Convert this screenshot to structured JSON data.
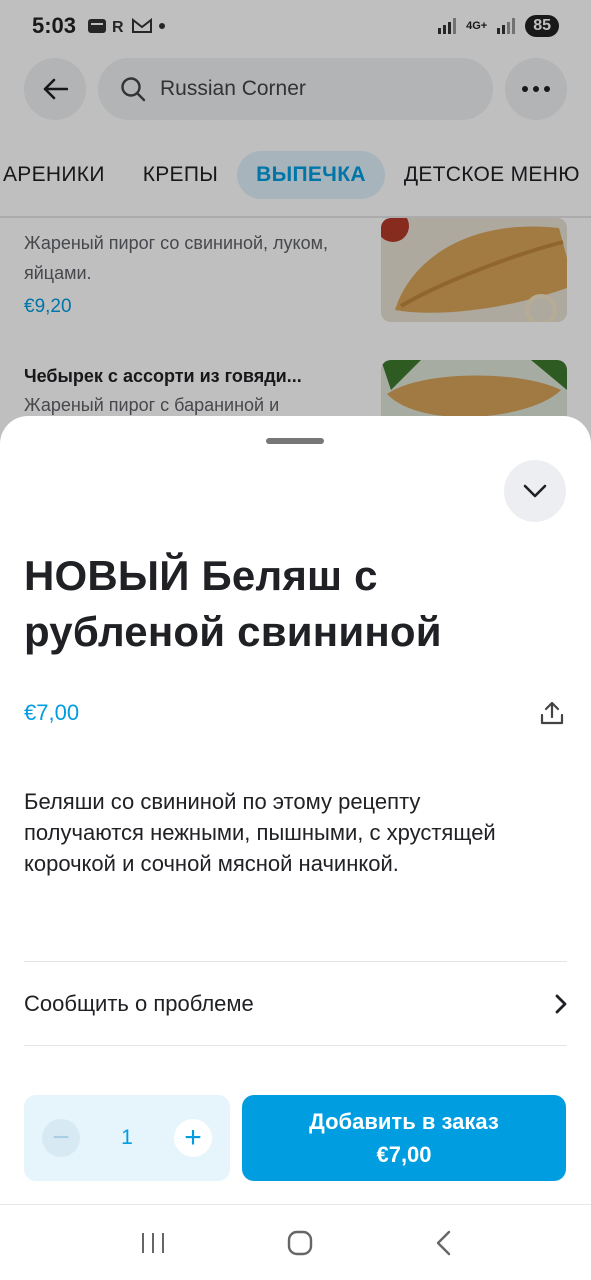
{
  "status_bar": {
    "time": "5:03",
    "left_icons": [
      "message-icon",
      "r-icon",
      "mail-icon",
      "dot-icon"
    ],
    "network_label": "4G+",
    "battery": "85"
  },
  "search": {
    "query": "Russian Corner"
  },
  "category_tabs": [
    {
      "label": "АРЕНИКИ",
      "active": false
    },
    {
      "label": "КРЕПЫ",
      "active": false
    },
    {
      "label": "ВЫПЕЧКА",
      "active": true
    },
    {
      "label": "ДЕТСКОЕ МЕНЮ",
      "active": false
    }
  ],
  "background_items": [
    {
      "title": "",
      "description": "Жареный пирог со свининой, луком, яйцами.",
      "price": "€9,20"
    },
    {
      "title": "Чебырек с ассорти из говяди...",
      "description": "Жареный пирог с бараниной и",
      "price": ""
    }
  ],
  "product": {
    "title": "НОВЫЙ Беляш с рубленой свининой",
    "price": "€7,00",
    "description": "Беляши со свининой по этому рецепту получаются нежными, пышными, с хрустящей корочкой и сочной мясной начинкой.",
    "report_label": "Сообщить о проблеме"
  },
  "order": {
    "quantity": "1",
    "minus_symbol": "−",
    "plus_symbol": "+",
    "add_label": "Добавить в заказ",
    "add_price": "€7,00"
  },
  "colors": {
    "accent": "#009de0",
    "accent_light": "#e6f4fb",
    "text": "#202125",
    "muted": "#5f6067"
  }
}
